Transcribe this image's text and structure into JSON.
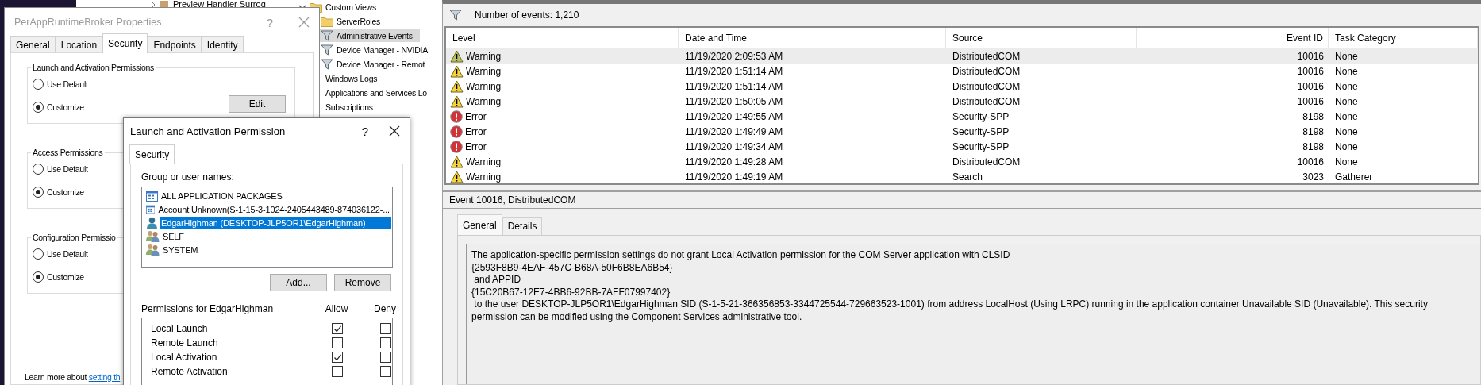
{
  "background_window": {
    "title": "Preview Handler Surrog"
  },
  "properties_dialog": {
    "title": "PerAppRuntimeBroker Properties",
    "help": "?",
    "tabs": [
      {
        "label": "General",
        "selected": false
      },
      {
        "label": "Location",
        "selected": false
      },
      {
        "label": "Security",
        "selected": true
      },
      {
        "label": "Endpoints",
        "selected": false
      },
      {
        "label": "Identity",
        "selected": false
      }
    ],
    "groups": [
      {
        "label": "Launch and Activation Permissions",
        "options": [
          {
            "label": "Use Default",
            "selected": false
          },
          {
            "label": "Customize",
            "selected": true
          }
        ],
        "button": "Edit"
      },
      {
        "label": "Access Permissions",
        "options": [
          {
            "label": "Use Default",
            "selected": false
          },
          {
            "label": "Customize",
            "selected": true
          }
        ]
      },
      {
        "label": "Configuration Permissio",
        "options": [
          {
            "label": "Use Default",
            "selected": false
          },
          {
            "label": "Customize",
            "selected": true
          }
        ]
      }
    ],
    "footer": {
      "text": "Learn more about ",
      "link": "setting th"
    }
  },
  "permission_dialog": {
    "title": "Launch and Activation Permission",
    "help": "?",
    "tabs": [
      {
        "label": "Security",
        "selected": true
      }
    ],
    "names_label": "Group or user names:",
    "names": [
      {
        "name": "ALL APPLICATION PACKAGES",
        "kind": "package",
        "selected": false
      },
      {
        "name": "Account Unknown(S-1-15-3-1024-2405443489-874036122-...",
        "kind": "account",
        "selected": false
      },
      {
        "name": "EdgarHighman (DESKTOP-JLP5OR1\\EdgarHighman)",
        "kind": "user",
        "selected": true
      },
      {
        "name": "SELF",
        "kind": "group",
        "selected": false
      },
      {
        "name": "SYSTEM",
        "kind": "group",
        "selected": false
      }
    ],
    "buttons": [
      "Add...",
      "Remove"
    ],
    "permissions_label": "Permissions for EdgarHighman",
    "columns": [
      "Allow",
      "Deny"
    ],
    "permissions": [
      {
        "name": "Local Launch",
        "allow": true,
        "deny": false
      },
      {
        "name": "Remote Launch",
        "allow": false,
        "deny": false
      },
      {
        "name": "Local Activation",
        "allow": true,
        "deny": false
      },
      {
        "name": "Remote Activation",
        "allow": false,
        "deny": false
      }
    ]
  },
  "tree": {
    "items": [
      {
        "label": "Custom Views",
        "kind": "folder",
        "expanded": true,
        "children": [
          {
            "label": "ServerRoles",
            "kind": "folder",
            "selected": false
          },
          {
            "label": "Administrative Events",
            "kind": "filter",
            "selected": true
          },
          {
            "label": "Device Manager - NVIDIA",
            "kind": "filter",
            "selected": false
          },
          {
            "label": "Device Manager - Remot",
            "kind": "filter",
            "selected": false
          }
        ]
      },
      {
        "label": "Windows Logs"
      },
      {
        "label": "Applications and Services Lo"
      },
      {
        "label": "Subscriptions"
      }
    ]
  },
  "event_list": {
    "count_label": "Number of events: 1,210",
    "columns": [
      "Level",
      "Date and Time",
      "Source",
      "Event ID",
      "Task Category"
    ],
    "rows": [
      {
        "kind": "warning",
        "level": "Warning",
        "date_and_time": "11/19/2020 2:09:53 AM",
        "source": "DistributedCOM",
        "event_id": "10016",
        "task_category": "None",
        "selected": true
      },
      {
        "kind": "warning",
        "level": "Warning",
        "date_and_time": "11/19/2020 1:51:14 AM",
        "source": "DistributedCOM",
        "event_id": "10016",
        "task_category": "None",
        "selected": false
      },
      {
        "kind": "warning",
        "level": "Warning",
        "date_and_time": "11/19/2020 1:51:14 AM",
        "source": "DistributedCOM",
        "event_id": "10016",
        "task_category": "None",
        "selected": false
      },
      {
        "kind": "warning",
        "level": "Warning",
        "date_and_time": "11/19/2020 1:50:05 AM",
        "source": "DistributedCOM",
        "event_id": "10016",
        "task_category": "None",
        "selected": false
      },
      {
        "kind": "error",
        "level": "Error",
        "date_and_time": "11/19/2020 1:49:55 AM",
        "source": "Security-SPP",
        "event_id": "8198",
        "task_category": "None",
        "selected": false
      },
      {
        "kind": "error",
        "level": "Error",
        "date_and_time": "11/19/2020 1:49:49 AM",
        "source": "Security-SPP",
        "event_id": "8198",
        "task_category": "None",
        "selected": false
      },
      {
        "kind": "error",
        "level": "Error",
        "date_and_time": "11/19/2020 1:49:34 AM",
        "source": "Security-SPP",
        "event_id": "8198",
        "task_category": "None",
        "selected": false
      },
      {
        "kind": "warning",
        "level": "Warning",
        "date_and_time": "11/19/2020 1:49:28 AM",
        "source": "DistributedCOM",
        "event_id": "10016",
        "task_category": "None",
        "selected": false
      },
      {
        "kind": "warning",
        "level": "Warning",
        "date_and_time": "11/19/2020 1:49:19 AM",
        "source": "Search",
        "event_id": "3023",
        "task_category": "Gatherer",
        "selected": false
      }
    ]
  },
  "event_detail": {
    "title": "Event 10016, DistributedCOM",
    "tabs": [
      {
        "label": "General",
        "selected": true
      },
      {
        "label": "Details",
        "selected": false
      }
    ],
    "description": "The application-specific permission settings do not grant Local Activation permission for the COM Server application with CLSID\n{2593F8B9-4EAF-457C-B68A-50F6B8EA6B54}\n and APPID\n{15C20B67-12E7-4BB6-92BB-7AFF07997402}\n to the user DESKTOP-JLP5OR1\\EdgarHighman SID (S-1-5-21-366356853-3344725544-729663523-1001) from address LocalHost (Using LRPC) running in the application container Unavailable SID (Unavailable). This security permission can be modified using the Component Services administrative tool."
  }
}
